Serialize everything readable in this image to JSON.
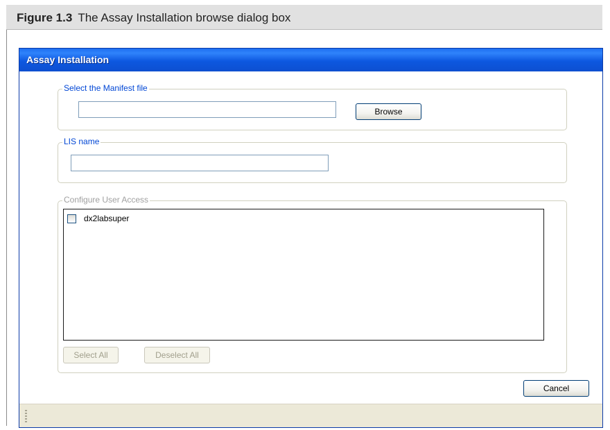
{
  "figure": {
    "number": "Figure 1.3",
    "caption": "The Assay Installation browse dialog box"
  },
  "window": {
    "title": "Assay Installation"
  },
  "manifest_group": {
    "legend": "Select the Manifest file",
    "input_value": "",
    "browse_label": "Browse"
  },
  "lis_group": {
    "legend": "LIS name",
    "input_value": ""
  },
  "access_group": {
    "legend": "Configure User Access",
    "users": [
      {
        "label": "dx2labsuper",
        "checked": false
      }
    ],
    "select_all_label": "Select All",
    "deselect_all_label": "Deselect All"
  },
  "actions": {
    "cancel_label": "Cancel"
  },
  "colors": {
    "titlebar": "#0d58e0",
    "legend_text": "#0046d5",
    "disabled_text": "#a0a0a0"
  }
}
